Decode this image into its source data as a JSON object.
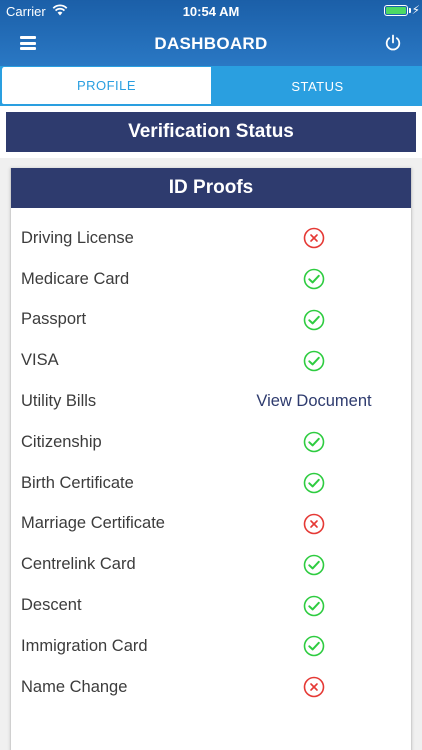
{
  "status_bar": {
    "carrier": "Carrier",
    "time": "10:54 AM"
  },
  "nav": {
    "title": "DASHBOARD",
    "menu_icon": "hamburger-menu-icon",
    "power_icon": "power-icon"
  },
  "tabs": [
    {
      "label": "PROFILE",
      "active": true
    },
    {
      "label": "STATUS",
      "active": false
    }
  ],
  "banner": {
    "title": "Verification Status"
  },
  "card": {
    "title": "ID Proofs",
    "rows": [
      {
        "label": "Driving License",
        "status": "rejected"
      },
      {
        "label": "Medicare Card",
        "status": "verified"
      },
      {
        "label": "Passport",
        "status": "verified"
      },
      {
        "label": "VISA",
        "status": "verified"
      },
      {
        "label": "Utility Bills",
        "status": "link",
        "link_text": "View Document"
      },
      {
        "label": "Citizenship",
        "status": "verified"
      },
      {
        "label": "Birth Certificate",
        "status": "verified"
      },
      {
        "label": "Marriage Certificate",
        "status": "rejected"
      },
      {
        "label": "Centrelink Card",
        "status": "verified"
      },
      {
        "label": "Descent",
        "status": "verified"
      },
      {
        "label": "Immigration Card",
        "status": "verified"
      },
      {
        "label": "Name Change",
        "status": "rejected"
      }
    ]
  },
  "colors": {
    "header_top": "#1b5fa8",
    "header_bottom": "#2a78c4",
    "tab_blue": "#2a9fe0",
    "navy": "#2e3b6e",
    "verified": "#2ecc40",
    "rejected": "#e53935"
  }
}
